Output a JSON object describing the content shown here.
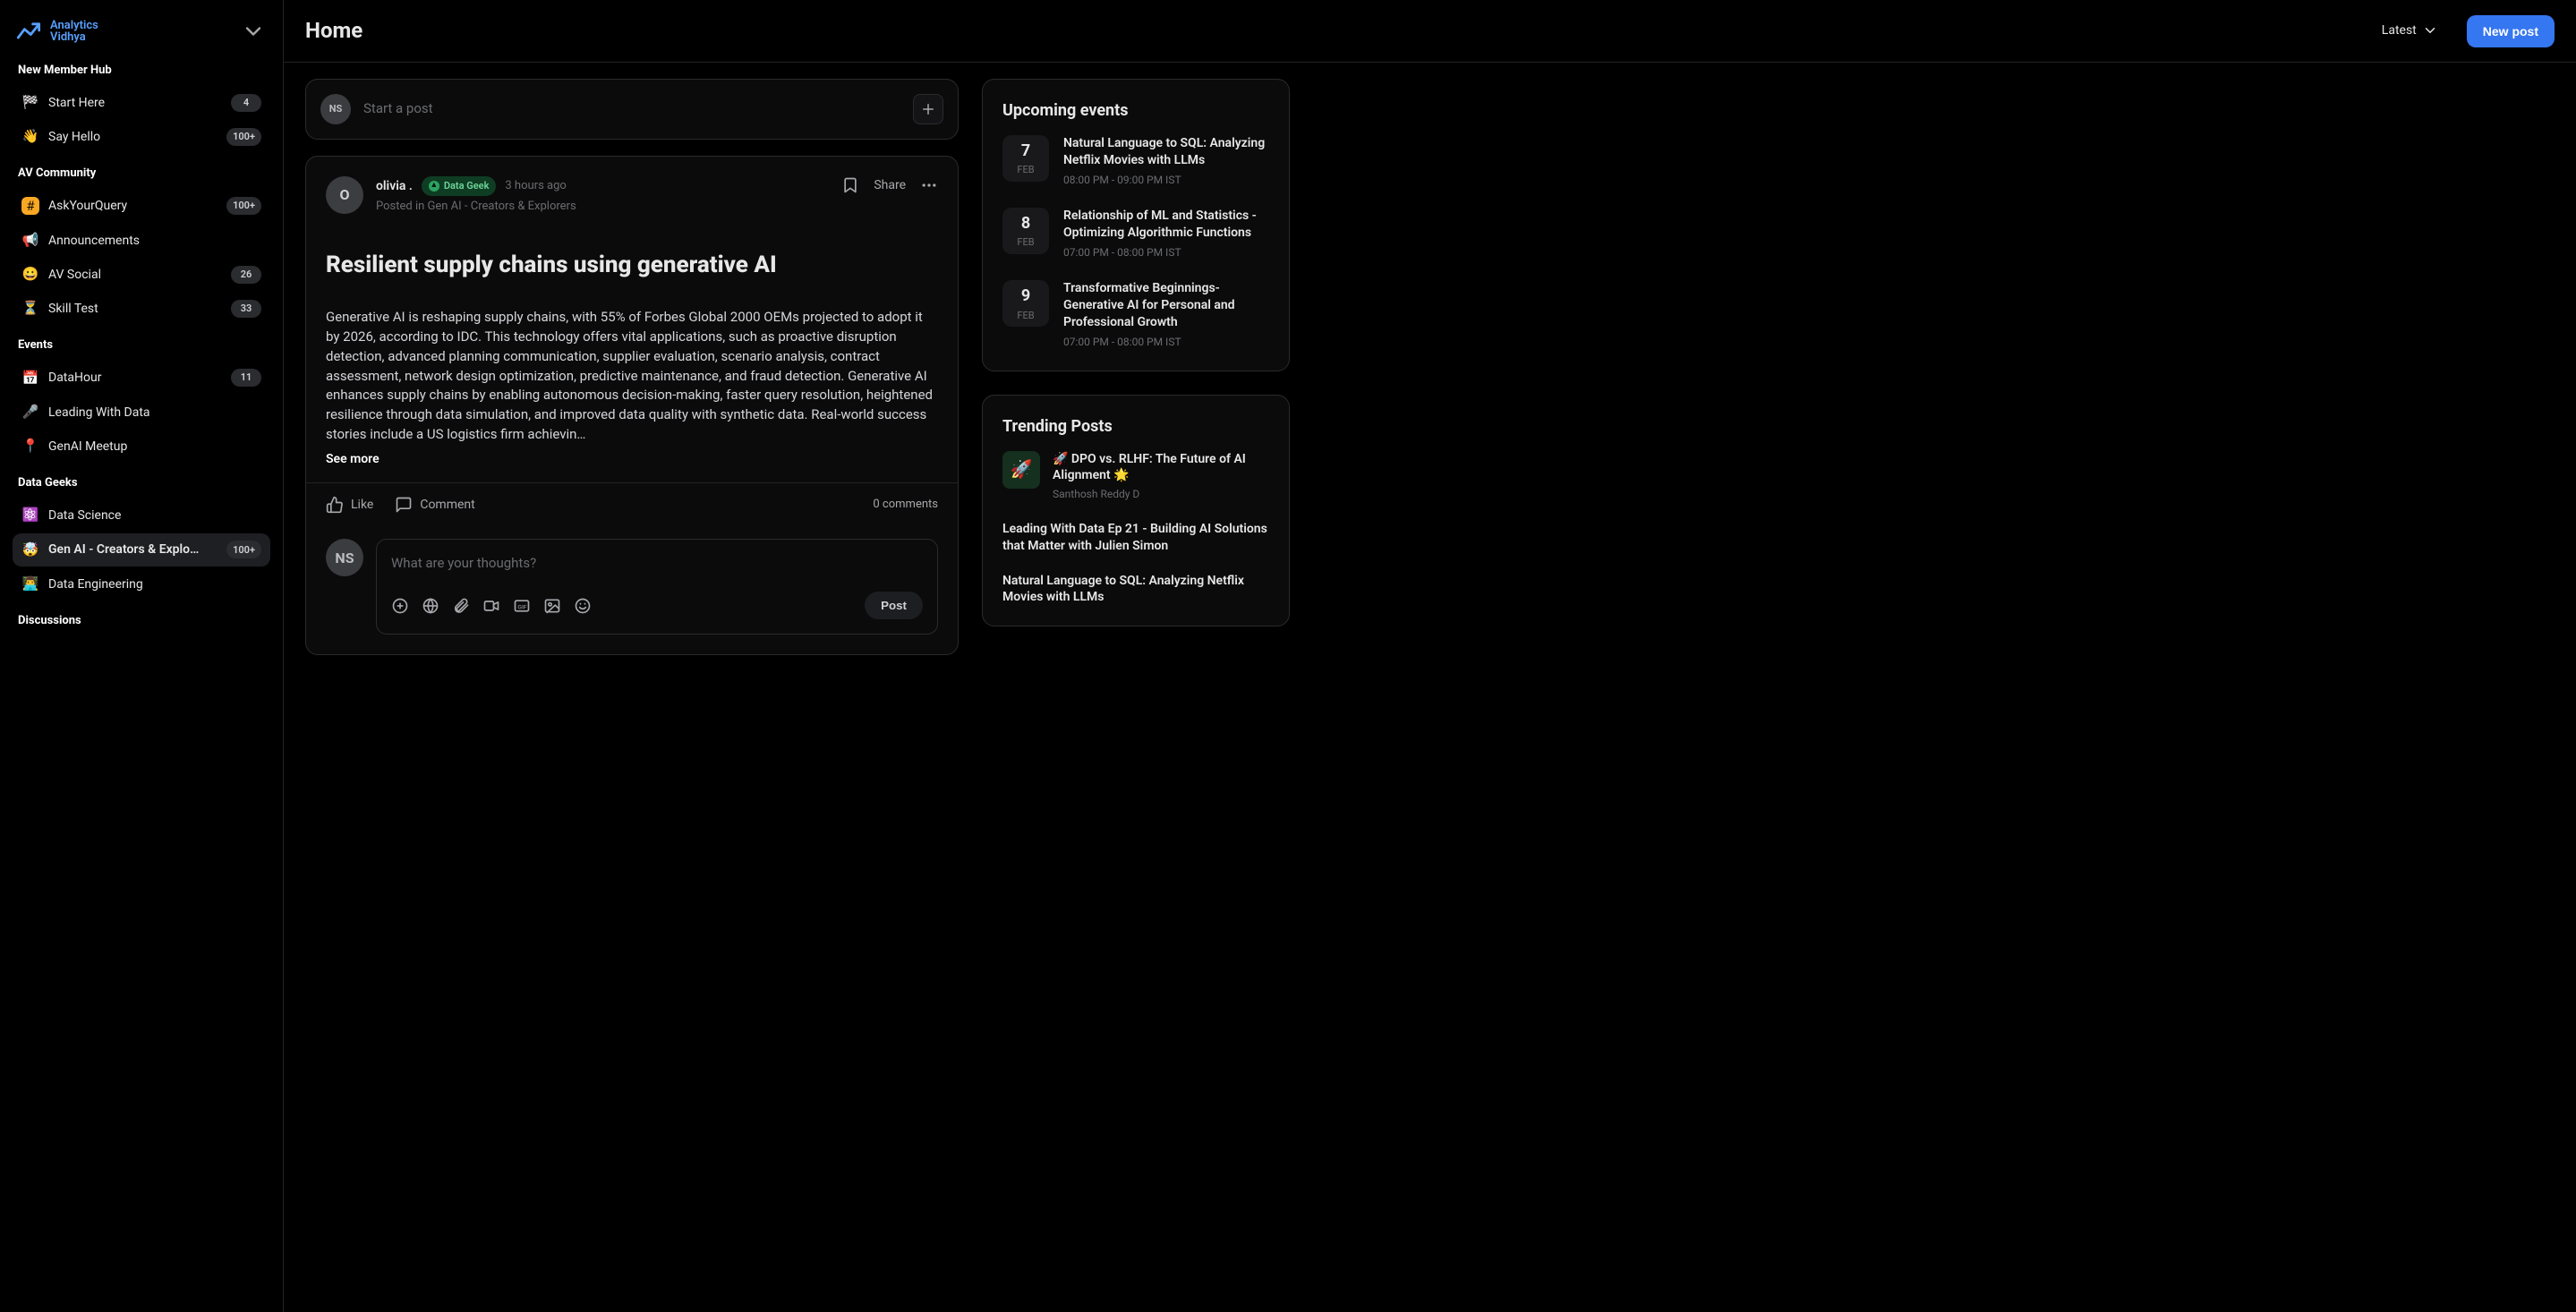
{
  "brand": {
    "name1": "Analytics",
    "name2": "Vidhya"
  },
  "topbar": {
    "title": "Home",
    "sort_label": "Latest",
    "new_post_label": "New post"
  },
  "sidebar": {
    "sections": [
      {
        "title": "New Member Hub",
        "items": [
          {
            "icon": "🏁",
            "label": "Start Here",
            "count": "4"
          },
          {
            "icon": "👋",
            "label": "Say Hello",
            "count": "100+"
          }
        ]
      },
      {
        "title": "AV Community",
        "items": [
          {
            "icon": "#",
            "label": "AskYourQuery",
            "count": "100+",
            "dotColor": "#f9a825"
          },
          {
            "icon": "📢",
            "label": "Announcements",
            "count": ""
          },
          {
            "icon": "😀",
            "label": "AV Social",
            "count": "26"
          },
          {
            "icon": "⏳",
            "label": "Skill Test",
            "count": "33"
          }
        ]
      },
      {
        "title": "Events",
        "items": [
          {
            "icon": "📅",
            "label": "DataHour",
            "count": "11"
          },
          {
            "icon": "🎤",
            "label": "Leading With Data",
            "count": ""
          },
          {
            "icon": "📍",
            "label": "GenAI Meetup",
            "count": ""
          }
        ]
      },
      {
        "title": "Data Geeks",
        "items": [
          {
            "icon": "⚛️",
            "label": "Data Science",
            "count": ""
          },
          {
            "icon": "🤯",
            "label": "Gen AI - Creators & Explo…",
            "count": "100+",
            "active": true
          },
          {
            "icon": "👨‍💻",
            "label": "Data Engineering",
            "count": ""
          }
        ]
      },
      {
        "title": "Discussions",
        "items": []
      }
    ]
  },
  "composer": {
    "initials": "NS",
    "prompt": "Start a post"
  },
  "post": {
    "avatar_letter": "O",
    "author": "olivia .",
    "badge": "Data Geek",
    "time": "3 hours ago",
    "posted_in_prefix": "Posted in",
    "posted_in": "Gen AI - Creators & Explorers",
    "share_label": "Share",
    "title": "Resilient supply chains using generative AI",
    "body": "Generative AI is reshaping supply chains, with 55% of Forbes Global 2000 OEMs projected to adopt it by 2026, according to IDC. This technology offers vital applications, such as proactive disruption detection, advanced planning communication, supplier evaluation, scenario analysis, contract assessment, network design optimization, predictive maintenance, and fraud detection. Generative AI enhances supply chains by enabling autonomous decision-making, faster query resolution, heightened resilience through data simulation, and improved data quality with synthetic data. Real-world success stories include a US logistics firm achievin…",
    "see_more": "See more",
    "like_label": "Like",
    "comment_label": "Comment",
    "comments_count": "0 comments"
  },
  "comment": {
    "initials": "NS",
    "placeholder": "What are your thoughts?",
    "post_label": "Post"
  },
  "events_card": {
    "title": "Upcoming events",
    "items": [
      {
        "day": "7",
        "month": "FEB",
        "title": "Natural Language to SQL: Analyzing Netflix Movies with LLMs",
        "time": "08:00 PM - 09:00 PM IST"
      },
      {
        "day": "8",
        "month": "FEB",
        "title": "Relationship of ML and Statistics - Optimizing Algorithmic Functions",
        "time": "07:00 PM - 08:00 PM IST"
      },
      {
        "day": "9",
        "month": "FEB",
        "title": "Transformative Beginnings- Generative AI for Personal and Professional Growth",
        "time": "07:00 PM - 08:00 PM IST"
      }
    ]
  },
  "trending_card": {
    "title": "Trending Posts",
    "items": [
      {
        "thumb": "🚀",
        "title": "🚀 DPO vs. RLHF: The Future of AI Alignment 🌟",
        "author": "Santhosh Reddy D"
      },
      {
        "thumb": "",
        "title": "Leading With Data Ep 21 - Building AI Solutions that Matter with Julien Simon",
        "author": ""
      },
      {
        "thumb": "",
        "title": "Natural Language to SQL: Analyzing Netflix Movies with LLMs",
        "author": ""
      }
    ]
  }
}
